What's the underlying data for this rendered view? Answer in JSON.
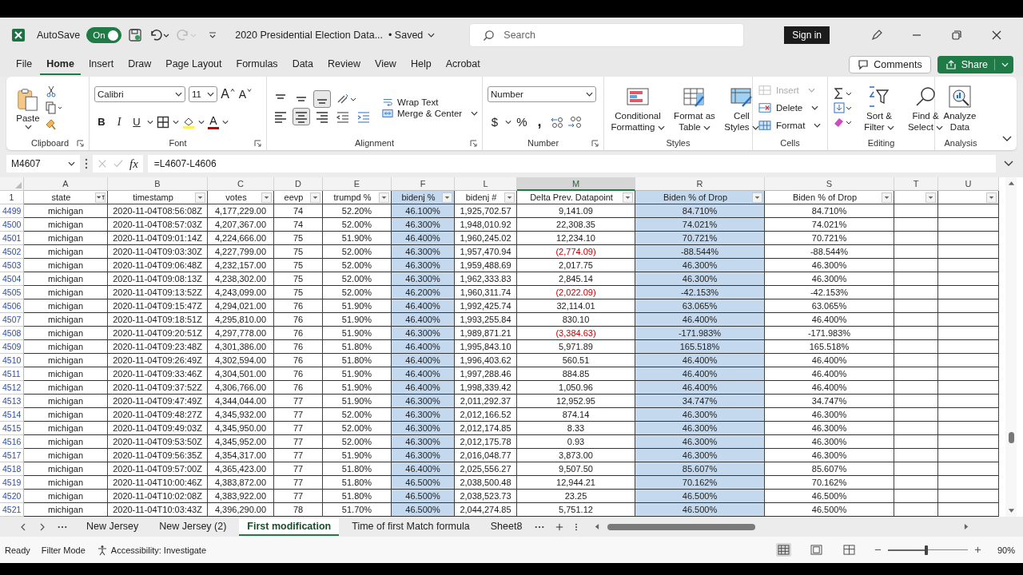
{
  "window": {
    "title": "2020 Presidential Election Data...",
    "save_status": "• Saved",
    "autosave_label": "AutoSave",
    "autosave": {
      "on": true,
      "label": "On"
    },
    "search_placeholder": "Search",
    "sign_in": "Sign in"
  },
  "menu_tabs": [
    {
      "label": "File",
      "selected": false
    },
    {
      "label": "Home",
      "selected": true
    },
    {
      "label": "Insert",
      "selected": false
    },
    {
      "label": "Draw",
      "selected": false
    },
    {
      "label": "Page Layout",
      "selected": false
    },
    {
      "label": "Formulas",
      "selected": false
    },
    {
      "label": "Data",
      "selected": false
    },
    {
      "label": "Review",
      "selected": false
    },
    {
      "label": "View",
      "selected": false
    },
    {
      "label": "Help",
      "selected": false
    },
    {
      "label": "Acrobat",
      "selected": false
    }
  ],
  "comments_button": "Comments",
  "share_button": "Share",
  "ribbon": {
    "clipboard": {
      "label": "Clipboard",
      "paste": "Paste"
    },
    "font": {
      "label": "Font",
      "family": "Calibri",
      "size": "11",
      "grow": "A",
      "shrink": "A",
      "bold": "B",
      "italic": "I",
      "underline": "U",
      "color_letter": "A"
    },
    "alignment": {
      "label": "Alignment",
      "vertical": [
        {
          "selected": false
        },
        {
          "selected": false
        },
        {
          "selected": true
        }
      ],
      "horizontal": [
        {
          "selected": false
        },
        {
          "selected": true
        },
        {
          "selected": false
        }
      ],
      "wrap_text": "Wrap Text",
      "merge_center": "Merge & Center"
    },
    "number": {
      "label": "Number",
      "format": "Number",
      "currency": "$",
      "percent": "%",
      "comma": ","
    },
    "styles": {
      "label": "Styles",
      "buttons": [
        {
          "label": "Conditional Formatting",
          "kind": "conditional"
        },
        {
          "label": "Format as Table",
          "kind": "table"
        },
        {
          "label": "Cell Styles",
          "kind": "cell"
        }
      ]
    },
    "cells": {
      "label": "Cells",
      "buttons": [
        {
          "label": "Insert",
          "kind": "insert",
          "disabled": true
        },
        {
          "label": "Delete",
          "kind": "delete",
          "disabled": false
        },
        {
          "label": "Format",
          "kind": "format",
          "disabled": false
        }
      ]
    },
    "editing": {
      "label": "Editing",
      "sort": "Sort & Filter",
      "find": "Find & Select"
    },
    "analysis": {
      "label": "Analysis",
      "analyze": "Analyze Data"
    }
  },
  "formula_bar": {
    "name_box": "M4607",
    "fx": "fx",
    "formula": "=L4607-L4606"
  },
  "columns": [
    {
      "letter": "A",
      "header": "state",
      "highlighted": false,
      "active": false,
      "filtered": true
    },
    {
      "letter": "B",
      "header": "timestamp",
      "highlighted": false,
      "active": false,
      "filtered": false
    },
    {
      "letter": "C",
      "header": "votes",
      "highlighted": false,
      "active": false,
      "filtered": false
    },
    {
      "letter": "D",
      "header": "eevp",
      "highlighted": false,
      "active": false,
      "filtered": false
    },
    {
      "letter": "E",
      "header": "trumpd %",
      "highlighted": false,
      "active": false,
      "filtered": false
    },
    {
      "letter": "F",
      "header": "bidenj %",
      "highlighted": true,
      "active": false,
      "filtered": false
    },
    {
      "letter": "L",
      "header": "bidenj #",
      "highlighted": false,
      "active": false,
      "filtered": false
    },
    {
      "letter": "M",
      "header": "Delta Prev. Datapoint",
      "highlighted": false,
      "active": true,
      "filtered": false
    },
    {
      "letter": "R",
      "header": "Biden % of Drop",
      "highlighted": true,
      "active": false,
      "filtered": false
    },
    {
      "letter": "S",
      "header": "Biden % of Drop",
      "highlighted": false,
      "active": false,
      "filtered": false
    },
    {
      "letter": "T",
      "highlighted": false,
      "active": false,
      "filtered": false
    },
    {
      "letter": "U",
      "highlighted": false,
      "active": false,
      "filtered": false
    }
  ],
  "header_row_number": "1",
  "rows": [
    {
      "number": "4499",
      "delta_negative": false,
      "cells": [
        "michigan",
        "2020-11-04T08:56:08Z",
        "4,177,229.00",
        "74",
        "52.20%",
        "46.100%",
        "1,925,702.57",
        "9,141.09",
        "84.710%",
        "84.710%"
      ]
    },
    {
      "number": "4500",
      "delta_negative": false,
      "cells": [
        "michigan",
        "2020-11-04T08:57:03Z",
        "4,207,367.00",
        "74",
        "52.00%",
        "46.300%",
        "1,948,010.92",
        "22,308.35",
        "74.021%",
        "74.021%"
      ]
    },
    {
      "number": "4501",
      "delta_negative": false,
      "cells": [
        "michigan",
        "2020-11-04T09:01:14Z",
        "4,224,666.00",
        "75",
        "51.90%",
        "46.400%",
        "1,960,245.02",
        "12,234.10",
        "70.721%",
        "70.721%"
      ]
    },
    {
      "number": "4502",
      "delta_negative": true,
      "cells": [
        "michigan",
        "2020-11-04T09:03:30Z",
        "4,227,799.00",
        "75",
        "52.00%",
        "46.300%",
        "1,957,470.94",
        "(2,774.09)",
        "-88.544%",
        "-88.544%"
      ]
    },
    {
      "number": "4503",
      "delta_negative": false,
      "cells": [
        "michigan",
        "2020-11-04T09:06:48Z",
        "4,232,157.00",
        "75",
        "52.00%",
        "46.300%",
        "1,959,488.69",
        "2,017.75",
        "46.300%",
        "46.300%"
      ]
    },
    {
      "number": "4504",
      "delta_negative": false,
      "cells": [
        "michigan",
        "2020-11-04T09:08:13Z",
        "4,238,302.00",
        "75",
        "52.00%",
        "46.300%",
        "1,962,333.83",
        "2,845.14",
        "46.300%",
        "46.300%"
      ]
    },
    {
      "number": "4505",
      "delta_negative": true,
      "cells": [
        "michigan",
        "2020-11-04T09:13:52Z",
        "4,243,099.00",
        "75",
        "52.00%",
        "46.200%",
        "1,960,311.74",
        "(2,022.09)",
        "-42.153%",
        "-42.153%"
      ]
    },
    {
      "number": "4506",
      "delta_negative": false,
      "cells": [
        "michigan",
        "2020-11-04T09:15:47Z",
        "4,294,021.00",
        "76",
        "51.90%",
        "46.400%",
        "1,992,425.74",
        "32,114.01",
        "63.065%",
        "63.065%"
      ]
    },
    {
      "number": "4507",
      "delta_negative": false,
      "cells": [
        "michigan",
        "2020-11-04T09:18:51Z",
        "4,295,810.00",
        "76",
        "51.90%",
        "46.400%",
        "1,993,255.84",
        "830.10",
        "46.400%",
        "46.400%"
      ]
    },
    {
      "number": "4508",
      "delta_negative": true,
      "cells": [
        "michigan",
        "2020-11-04T09:20:51Z",
        "4,297,778.00",
        "76",
        "51.90%",
        "46.300%",
        "1,989,871.21",
        "(3,384.63)",
        "-171.983%",
        "-171.983%"
      ]
    },
    {
      "number": "4509",
      "delta_negative": false,
      "cells": [
        "michigan",
        "2020-11-04T09:23:48Z",
        "4,301,386.00",
        "76",
        "51.80%",
        "46.400%",
        "1,995,843.10",
        "5,971.89",
        "165.518%",
        "165.518%"
      ]
    },
    {
      "number": "4510",
      "delta_negative": false,
      "cells": [
        "michigan",
        "2020-11-04T09:26:49Z",
        "4,302,594.00",
        "76",
        "51.80%",
        "46.400%",
        "1,996,403.62",
        "560.51",
        "46.400%",
        "46.400%"
      ]
    },
    {
      "number": "4511",
      "delta_negative": false,
      "cells": [
        "michigan",
        "2020-11-04T09:33:46Z",
        "4,304,501.00",
        "76",
        "51.90%",
        "46.400%",
        "1,997,288.46",
        "884.85",
        "46.400%",
        "46.400%"
      ]
    },
    {
      "number": "4512",
      "delta_negative": false,
      "cells": [
        "michigan",
        "2020-11-04T09:37:52Z",
        "4,306,766.00",
        "76",
        "51.90%",
        "46.400%",
        "1,998,339.42",
        "1,050.96",
        "46.400%",
        "46.400%"
      ]
    },
    {
      "number": "4513",
      "delta_negative": false,
      "cells": [
        "michigan",
        "2020-11-04T09:47:49Z",
        "4,344,044.00",
        "77",
        "51.90%",
        "46.300%",
        "2,011,292.37",
        "12,952.95",
        "34.747%",
        "34.747%"
      ]
    },
    {
      "number": "4514",
      "delta_negative": false,
      "cells": [
        "michigan",
        "2020-11-04T09:48:27Z",
        "4,345,932.00",
        "77",
        "52.00%",
        "46.300%",
        "2,012,166.52",
        "874.14",
        "46.300%",
        "46.300%"
      ]
    },
    {
      "number": "4515",
      "delta_negative": false,
      "cells": [
        "michigan",
        "2020-11-04T09:49:03Z",
        "4,345,950.00",
        "77",
        "52.00%",
        "46.300%",
        "2,012,174.85",
        "8.33",
        "46.300%",
        "46.300%"
      ]
    },
    {
      "number": "4516",
      "delta_negative": false,
      "cells": [
        "michigan",
        "2020-11-04T09:53:50Z",
        "4,345,952.00",
        "77",
        "52.00%",
        "46.300%",
        "2,012,175.78",
        "0.93",
        "46.300%",
        "46.300%"
      ]
    },
    {
      "number": "4517",
      "delta_negative": false,
      "cells": [
        "michigan",
        "2020-11-04T09:56:35Z",
        "4,354,317.00",
        "77",
        "51.90%",
        "46.300%",
        "2,016,048.77",
        "3,873.00",
        "46.300%",
        "46.300%"
      ]
    },
    {
      "number": "4518",
      "delta_negative": false,
      "cells": [
        "michigan",
        "2020-11-04T09:57:00Z",
        "4,365,423.00",
        "77",
        "51.80%",
        "46.400%",
        "2,025,556.27",
        "9,507.50",
        "85.607%",
        "85.607%"
      ]
    },
    {
      "number": "4519",
      "delta_negative": false,
      "cells": [
        "michigan",
        "2020-11-04T10:00:46Z",
        "4,383,872.00",
        "77",
        "51.80%",
        "46.500%",
        "2,038,500.48",
        "12,944.21",
        "70.162%",
        "70.162%"
      ]
    },
    {
      "number": "4520",
      "delta_negative": false,
      "cells": [
        "michigan",
        "2020-11-04T10:02:08Z",
        "4,383,922.00",
        "77",
        "51.80%",
        "46.500%",
        "2,038,523.73",
        "23.25",
        "46.500%",
        "46.500%"
      ]
    },
    {
      "number": "4521",
      "delta_negative": false,
      "cells": [
        "michigan",
        "2020-11-04T10:03:43Z",
        "4,396,290.00",
        "78",
        "51.70%",
        "46.500%",
        "2,044,274.85",
        "5,751.12",
        "46.500%",
        "46.500%"
      ]
    }
  ],
  "sheet_tabs": [
    {
      "label": "New Jersey",
      "selected": false
    },
    {
      "label": "New Jersey (2)",
      "selected": false
    },
    {
      "label": "First modification",
      "selected": true
    },
    {
      "label": "Time of first Match formula",
      "selected": false
    },
    {
      "label": "Sheet8",
      "selected": false
    }
  ],
  "status_bar": {
    "ready": "Ready",
    "mode": "Filter Mode",
    "accessibility": "Accessibility: Investigate",
    "views": [
      {
        "kind": "normal",
        "selected": true
      },
      {
        "kind": "page_layout",
        "selected": false
      },
      {
        "kind": "page_break",
        "selected": false
      }
    ],
    "zoom": {
      "level": 0.48,
      "label": "90%"
    }
  }
}
